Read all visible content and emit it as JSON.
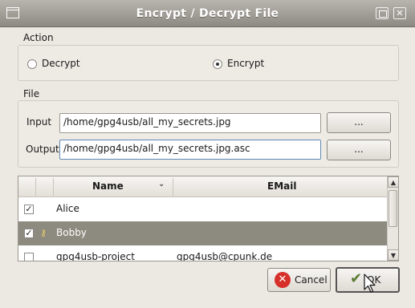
{
  "window": {
    "title": "Encrypt / Decrypt File"
  },
  "action": {
    "legend": "Action",
    "decrypt_label": "Decrypt",
    "encrypt_label": "Encrypt",
    "selected": "Encrypt"
  },
  "file": {
    "legend": "File",
    "input_label": "Input",
    "input_value": "/home/gpg4usb/all_my_secrets.jpg",
    "input_browse": "...",
    "output_label": "Output",
    "output_value": "/home/gpg4usb/all_my_secrets.jpg.asc",
    "output_browse": "..."
  },
  "keys": {
    "columns": [
      "Name",
      "EMail"
    ],
    "rows": [
      {
        "checked": true,
        "name": "Alice",
        "email": "",
        "selected": false
      },
      {
        "checked": true,
        "name": "Bobby",
        "email": "",
        "selected": true
      },
      {
        "checked": false,
        "name": "gpg4usb-project",
        "email": "gpg4usb@cpunk.de",
        "selected": false
      }
    ]
  },
  "buttons": {
    "cancel": "Cancel",
    "ok": "OK"
  },
  "colors": {
    "title_bar": "#9a978f",
    "selection": "#8d8a7f",
    "cancel_icon": "#d6302a",
    "ok_icon": "#5a7a34"
  },
  "icons": {
    "window": "window-icon",
    "maximize": "maximize-icon",
    "close": "close-icon",
    "cancel": "cancel-icon",
    "ok": "ok-check-icon",
    "key": "key-icon",
    "sort": "sort-chevron-icon"
  }
}
